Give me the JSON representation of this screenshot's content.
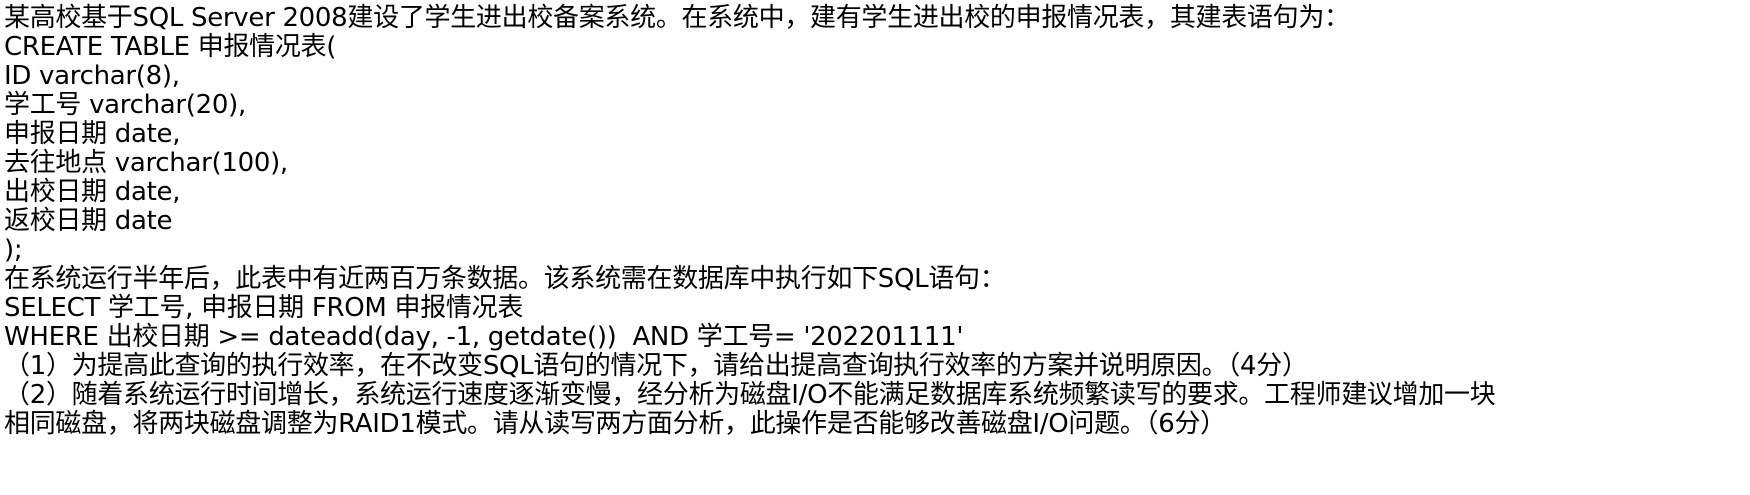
{
  "document": {
    "lines": [
      "某高校基于SQL Server 2008建设了学生进出校备案系统。在系统中，建有学生进出校的申报情况表，其建表语句为：",
      "CREATE TABLE 申报情况表(",
      "ID varchar(8),",
      "学工号 varchar(20),",
      "申报日期 date,",
      "去往地点 varchar(100),",
      "出校日期 date,",
      "返校日期 date",
      ");",
      "在系统运行半年后，此表中有近两百万条数据。该系统需在数据库中执行如下SQL语句：",
      "SELECT 学工号, 申报日期 FROM 申报情况表",
      "WHERE 出校日期 >= dateadd(day, -1, getdate())  AND 学工号= '202201111'",
      "（1）为提高此查询的执行效率，在不改变SQL语句的情况下，请给出提高查询执行效率的方案并说明原因。（4分）"
    ],
    "question2": {
      "line1": "（2）随着系统运行时间增长，系统运行速度逐渐变慢，经分析为磁盘I/O不能满足数据库系统频繁读写的要求。工程师建议增加一块",
      "line2": "相同磁盘，将两块磁盘调整为RAID1模式。请从读写两方面分析，此操作是否能够改善磁盘I/O问题。（6分）"
    }
  }
}
